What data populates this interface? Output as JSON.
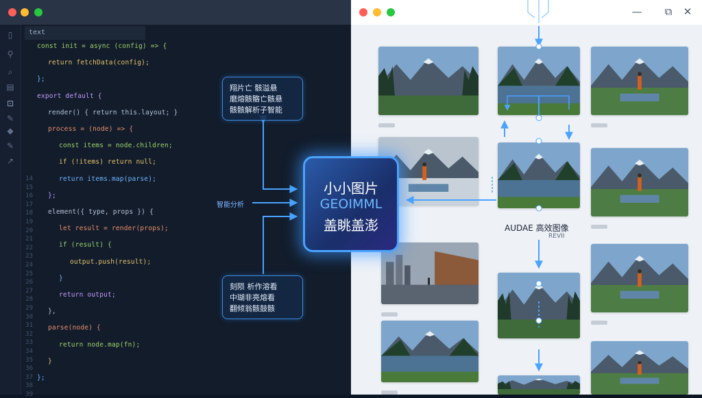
{
  "editor": {
    "tab_label": "text",
    "line_numbers": [
      "14",
      "15",
      "16",
      "17",
      "18",
      "19",
      "20",
      "21",
      "22",
      "23",
      "24",
      "25",
      "26",
      "27",
      "28",
      "29",
      "30",
      "31",
      "32",
      "33",
      "34",
      "35",
      "36",
      "37",
      "38",
      "39"
    ],
    "code_lines": [
      "const init = async (config) => {",
      "  return fetchData(config);",
      "};",
      "export default {",
      "  render() { return this.layout; }",
      "  process = (node) => {",
      "    const items = node.children;",
      "    if (!items) return null;",
      "    return items.map(parse);",
      "  };",
      "  element({ type, props }) {",
      "    let result = render(props);",
      "    if (result) {",
      "      output.push(result);",
      "    }",
      "    return output;",
      "  },",
      "  parse(node) {",
      "    return node.map(fn);",
      "  }",
      "};"
    ]
  },
  "hub": {
    "line1": "小小图片",
    "line2": "GEOIMML",
    "line3": "盖眺盖澎"
  },
  "boxes": {
    "top": [
      "翔片亡 骸溢悬",
      "磨熔骸骼亡骸悬",
      "骸骸解析子智能"
    ],
    "bottom": [
      "刻陨 析作溶看",
      "中瑚非亮熔看",
      "翻倾翁骸鼓骸"
    ],
    "side_label": "智能分析"
  },
  "right_panel": {
    "label_line1": "AUDAE 高效图像",
    "label_line2": "REVII"
  },
  "colors": {
    "accent": "#4aa3ff",
    "traffic_red": "#ff5f57",
    "traffic_yellow": "#febc2e",
    "traffic_green": "#28c840"
  }
}
